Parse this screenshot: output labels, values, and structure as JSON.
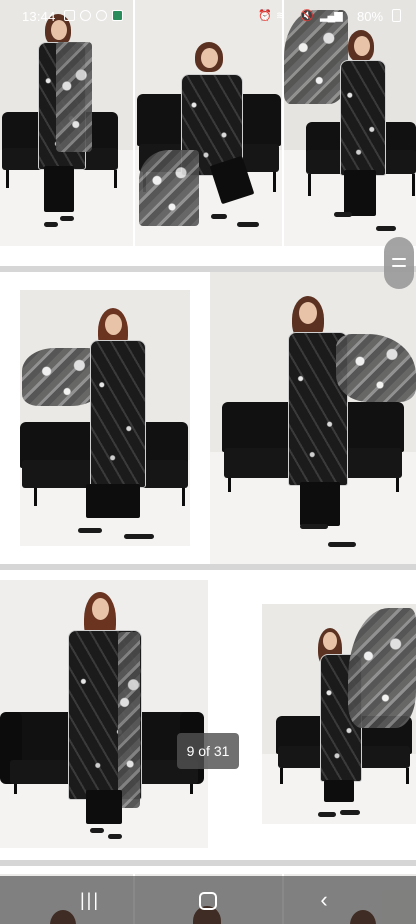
{
  "status_bar": {
    "time": "13:44",
    "battery": "80%",
    "left_icons": [
      "gallery-icon",
      "message-icon",
      "whatsapp-icon",
      "app-icon"
    ],
    "right_icons": [
      "alarm-icon",
      "wifi-icon",
      "volume-icon",
      "signal-icon",
      "battery-icon"
    ]
  },
  "viewer": {
    "page_counter": "9 of 31",
    "current_page": 9,
    "total_pages": 31
  },
  "nav_bar": {
    "recents_icon": "recents-icon",
    "home_icon": "home-icon",
    "back_icon": "back-icon"
  },
  "colors": {
    "accent_dark": "#111111",
    "background": "#ffffff",
    "separator": "#d6d6d6",
    "counter_bg": "#505050"
  }
}
